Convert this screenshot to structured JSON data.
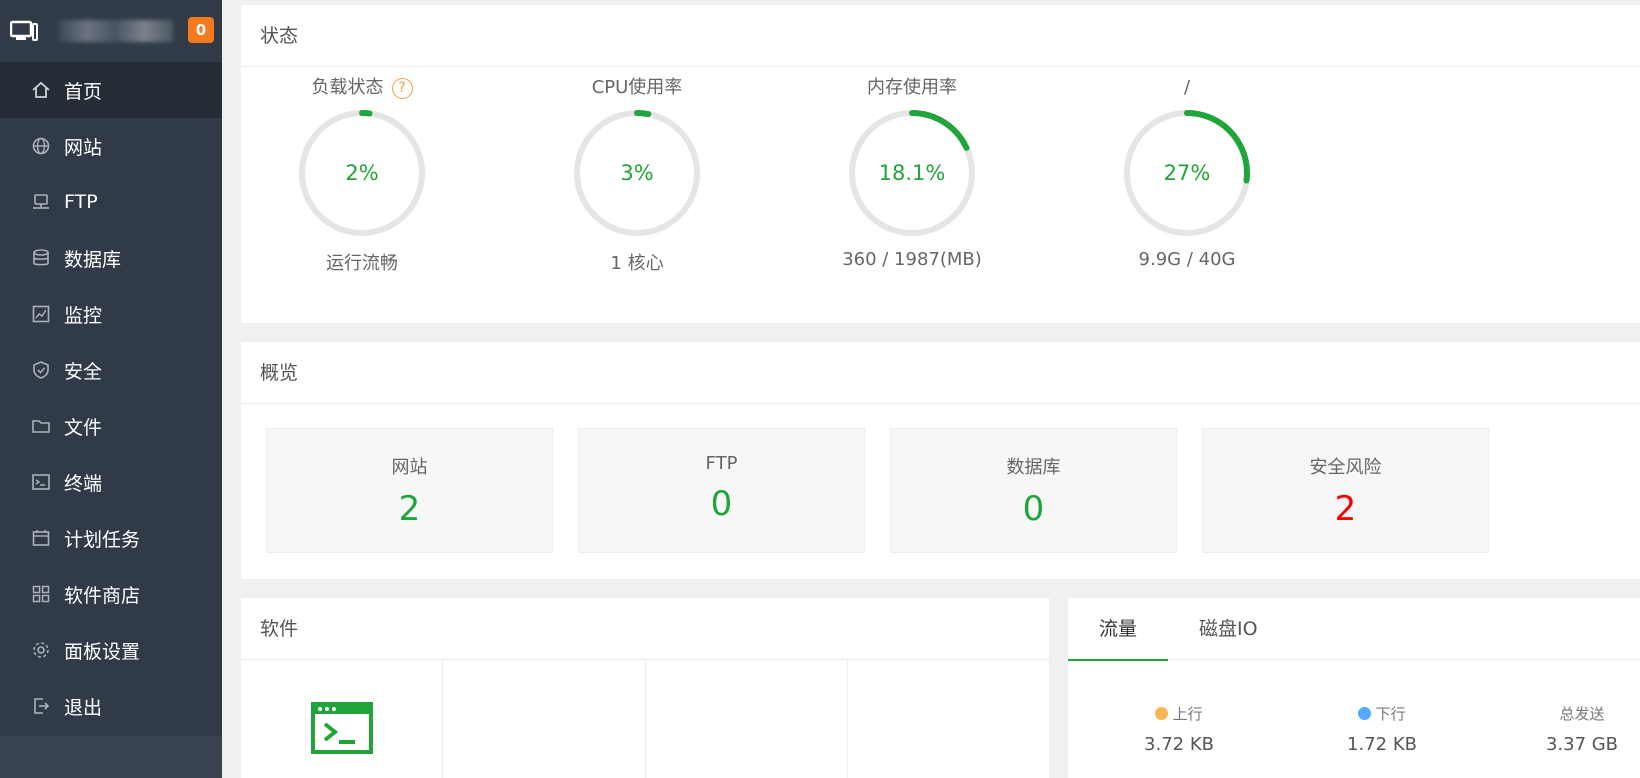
{
  "sidebar": {
    "badge": "0",
    "items": [
      {
        "label": "首页",
        "icon": "home-icon",
        "active": true
      },
      {
        "label": "网站",
        "icon": "globe-icon"
      },
      {
        "label": "FTP",
        "icon": "ftp-icon"
      },
      {
        "label": "数据库",
        "icon": "database-icon"
      },
      {
        "label": "监控",
        "icon": "monitor-chart-icon"
      },
      {
        "label": "安全",
        "icon": "shield-icon"
      },
      {
        "label": "文件",
        "icon": "folder-icon"
      },
      {
        "label": "终端",
        "icon": "terminal-icon"
      },
      {
        "label": "计划任务",
        "icon": "calendar-icon"
      },
      {
        "label": "软件商店",
        "icon": "apps-icon"
      },
      {
        "label": "面板设置",
        "icon": "gear-icon"
      },
      {
        "label": "退出",
        "icon": "logout-icon"
      }
    ]
  },
  "status": {
    "title": "状态",
    "gauges": [
      {
        "title": "负载状态",
        "value": "2%",
        "percent": 2,
        "footer": "运行流畅"
      },
      {
        "title": "CPU使用率",
        "value": "3%",
        "percent": 3,
        "footer": "1 核心"
      },
      {
        "title": "内存使用率",
        "value": "18.1%",
        "percent": 18.1,
        "footer": "360 / 1987(MB)"
      },
      {
        "title": "/",
        "value": "27%",
        "percent": 27,
        "footer": "9.9G / 40G"
      }
    ],
    "help_glyph": "?"
  },
  "overview": {
    "title": "概览",
    "cards": [
      {
        "label": "网站",
        "value": "2"
      },
      {
        "label": "FTP",
        "value": "0"
      },
      {
        "label": "数据库",
        "value": "0"
      },
      {
        "label": "安全风险",
        "value": "2"
      }
    ]
  },
  "software": {
    "title": "软件"
  },
  "traffic": {
    "tabs": [
      "流量",
      "磁盘IO"
    ],
    "stats": [
      {
        "label": "上行",
        "value": "3.72 KB",
        "dot_color": "#f7b851"
      },
      {
        "label": "下行",
        "value": "1.72 KB",
        "dot_color": "#52a9ff"
      },
      {
        "label": "总发送",
        "value": "3.37 GB"
      }
    ]
  },
  "colors": {
    "accent": "#20a53a",
    "danger": "#ff0000",
    "sidebar_bg": "#313b47",
    "badge": "#f37b1d"
  }
}
